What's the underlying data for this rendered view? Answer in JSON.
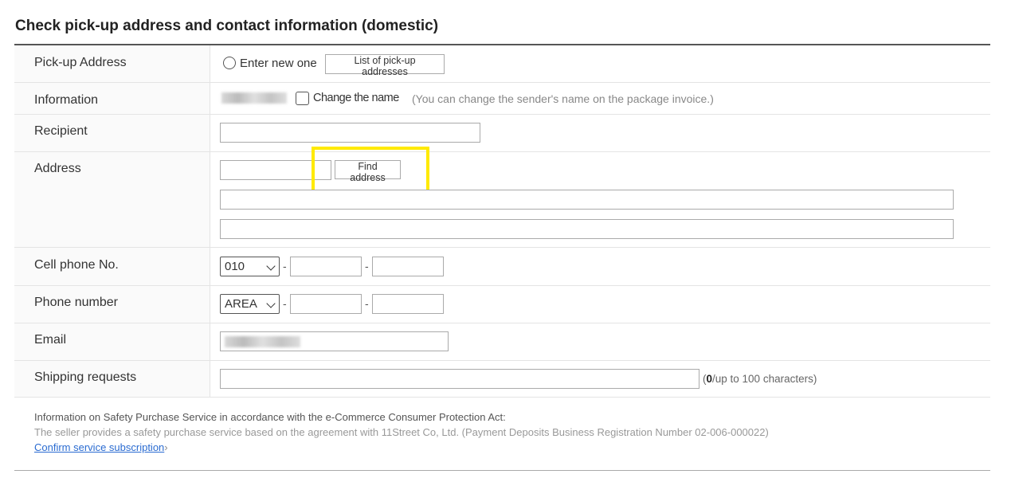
{
  "title": "Check pick-up address and contact information (domestic)",
  "rows": {
    "pickup": {
      "label": "Pick-up Address",
      "radio_label": "Enter new one",
      "list_button": "List of pick-up addresses"
    },
    "information": {
      "label": "Information",
      "checkbox_label": "Change the name",
      "hint": "(You can change the sender's name on the package invoice.)"
    },
    "recipient": {
      "label": "Recipient"
    },
    "address": {
      "label": "Address",
      "find_button": "Find address"
    },
    "cell": {
      "label": "Cell phone No.",
      "prefix": "010",
      "sep": "-"
    },
    "phone": {
      "label": "Phone number",
      "prefix": "AREA",
      "sep": "-"
    },
    "email": {
      "label": "Email"
    },
    "shipping": {
      "label": "Shipping requests",
      "count": "0",
      "count_suffix": "/up to 100 characters)",
      "count_prefix": "("
    }
  },
  "footer": {
    "line1": "Information on Safety Purchase Service in accordance with the e-Commerce Consumer Protection Act:",
    "line2": "The seller provides a safety purchase service based on the agreement with 11Street Co, Ltd. (Payment Deposits Business Registration Number 02-006-000022)",
    "link": "Confirm service subscription",
    "link_chevron": "›"
  },
  "colors": {
    "highlight": "#ffea00",
    "link": "#2a6bd1"
  }
}
